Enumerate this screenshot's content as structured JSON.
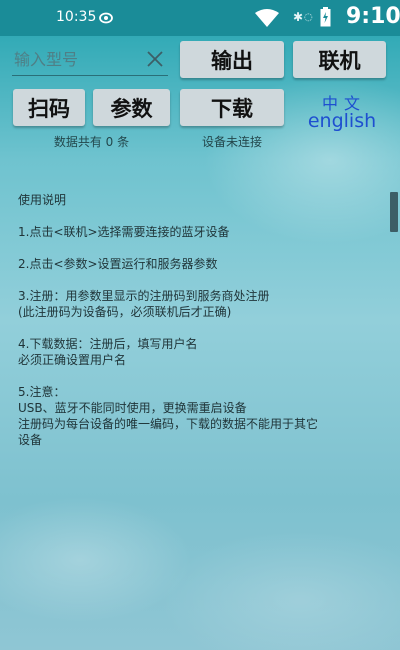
{
  "status_bar": {
    "time": "10:35",
    "clock_large": "9:10",
    "icons": [
      "eye-icon",
      "wifi-icon",
      "bluetooth-icon",
      "battery-icon"
    ]
  },
  "toolbar": {
    "model_input": {
      "value": "",
      "placeholder": "输入型号"
    },
    "output_label": "输出",
    "connect_label": "联机",
    "scan_label": "扫码",
    "params_label": "参数",
    "download_label": "下载"
  },
  "language": {
    "chinese": "中文",
    "english": "english"
  },
  "status": {
    "record_count": "数据共有 0 条",
    "connection": "设备未连接"
  },
  "instructions": {
    "title": "使用说明",
    "step1": "1.点击<联机>选择需要连接的蓝牙设备",
    "step2": "2.点击<参数>设置运行和服务器参数",
    "step3_a": "3.注册：用参数里显示的注册码到服务商处注册",
    "step3_b": "(此注册码为设备码，必须联机后才正确)",
    "step4_a": "4.下载数据：注册后，填写用户名",
    "step4_b": "必须正确设置用户名",
    "step5_a": "5.注意：",
    "step5_b": "USB、蓝牙不能同时使用，更换需重启设备",
    "step5_c": "注册码为每台设备的唯一编码，下载的数据不能用于其它",
    "step5_d": "设备"
  },
  "colors": {
    "status_bar": "#1a8c98",
    "button_bg": "#cfd8dc",
    "language_link": "#1e4fd0",
    "text_dark": "#1f3438"
  }
}
